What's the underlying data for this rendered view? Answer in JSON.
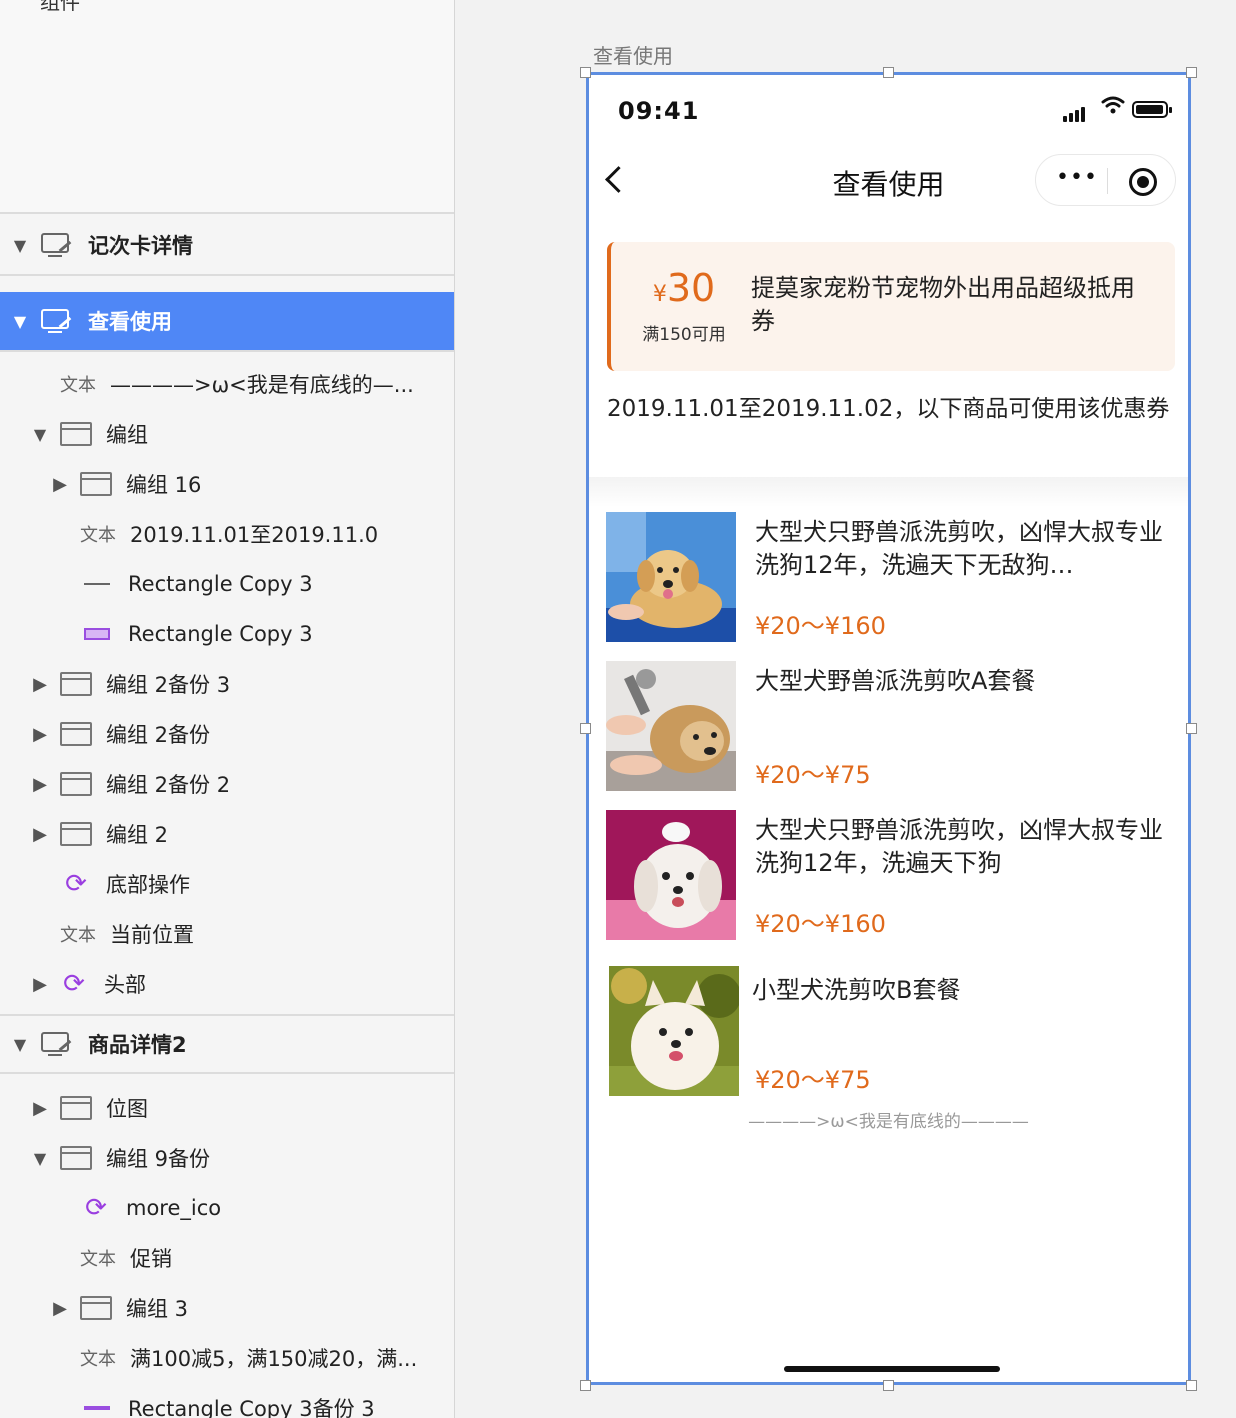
{
  "layers": {
    "top_clipped_label": "组件",
    "artboards": [
      {
        "label": "记次卡详情"
      },
      {
        "label": "查看使用"
      },
      {
        "label": "商品详情2"
      }
    ],
    "items": [
      {
        "type_label": "文本",
        "label": "————>ω<我是有底线的—..."
      },
      {
        "label": "编组"
      },
      {
        "label": "编组 16"
      },
      {
        "type_label": "文本",
        "label": "2019.11.01至2019.11.0"
      },
      {
        "label": "Rectangle Copy 3"
      },
      {
        "label": "Rectangle Copy 3"
      },
      {
        "label": "编组 2备份 3"
      },
      {
        "label": "编组 2备份"
      },
      {
        "label": "编组 2备份 2"
      },
      {
        "label": "编组 2"
      },
      {
        "label": "底部操作"
      },
      {
        "type_label": "文本",
        "label": "当前位置"
      },
      {
        "label": "头部"
      },
      {
        "label": "位图"
      },
      {
        "label": "编组 9备份"
      },
      {
        "label": "more_ico"
      },
      {
        "type_label": "文本",
        "label": "促销"
      },
      {
        "label": "编组 3"
      },
      {
        "type_label": "文本",
        "label": "满100减5，满150减20，满..."
      },
      {
        "label": "Rectangle Copy 3备份 3"
      }
    ]
  },
  "canvas": {
    "artboard_label": "查看使用"
  },
  "phone": {
    "status_time": "09:41",
    "nav_title": "查看使用",
    "nav_more": "•••",
    "coupon": {
      "currency": "¥",
      "amount": "30",
      "condition": "满150可用",
      "title": "提莫家宠粉节宠物外出用品超级抵用券",
      "accent_color": "#e06a1c"
    },
    "validity_text": "2019.11.01至2019.11.02，以下商品可使用该优惠券",
    "products": [
      {
        "name": "大型犬只野兽派洗剪吹，凶悍大叔专业洗狗12年，洗遍天下无敌狗…",
        "price": "¥20～¥160"
      },
      {
        "name": "大型犬野兽派洗剪吹A套餐",
        "price": "¥20～¥75"
      },
      {
        "name": "大型犬只野兽派洗剪吹，凶悍大叔专业洗狗12年，洗遍天下狗",
        "price": "¥20～¥160"
      },
      {
        "name": "小型犬洗剪吹B套餐",
        "price": "¥20～¥75"
      }
    ],
    "bottom_line": "————>ω<我是有底线的————"
  }
}
